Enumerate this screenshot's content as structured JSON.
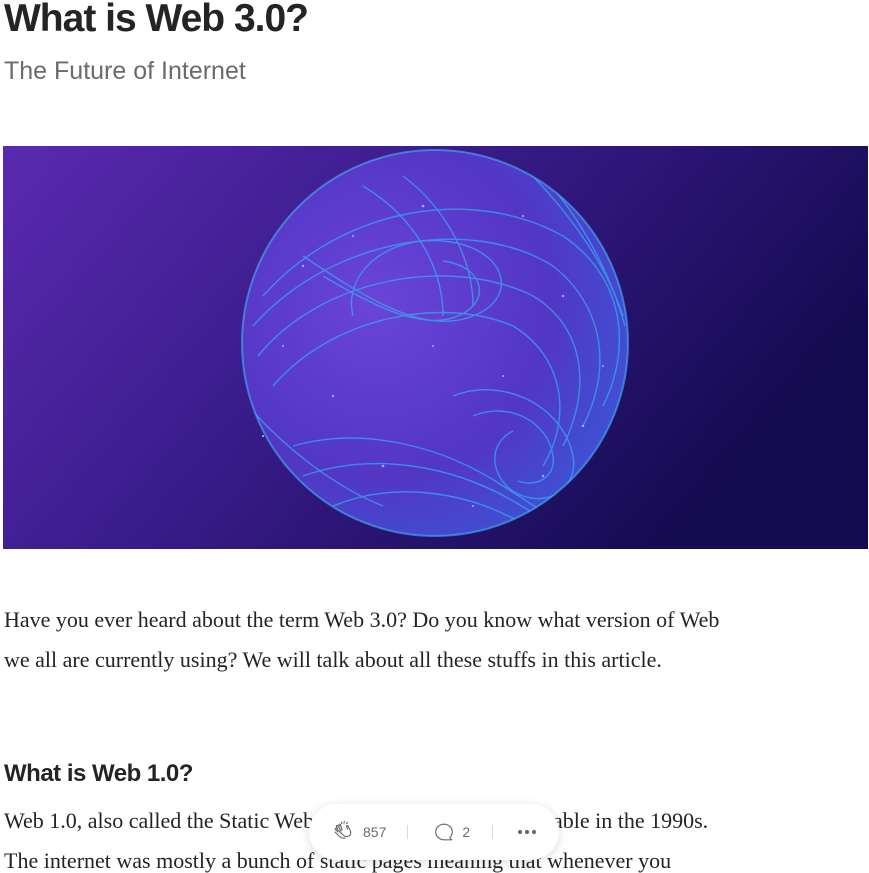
{
  "article": {
    "title": "What is Web 3.0?",
    "subtitle": "The Future of Internet",
    "hero_image": {
      "description_icon": "globe-illustration",
      "colors": {
        "background_light": "#5a2ab0",
        "background_dark": "#150b52",
        "sphere": "#5b3fd0",
        "lines": "#3aa6f2"
      }
    },
    "intro_lines": [
      "Have you ever heard about the term Web 3.0? Do you know what version of Web",
      "we all are currently using? We will talk about all these stuffs in this article."
    ],
    "section_heading": "What is Web 1.0?",
    "section_lines": [
      "Web 1.0, also called the Static Web, was the first and most reliable in the 1990s.",
      "The internet was mostly a bunch of static pages meaning that whenever you"
    ]
  },
  "action_bar": {
    "clap_icon": "clap-icon",
    "clap_count": "857",
    "response_icon": "comment-icon",
    "response_count": "2",
    "more_icon": "more-icon"
  }
}
